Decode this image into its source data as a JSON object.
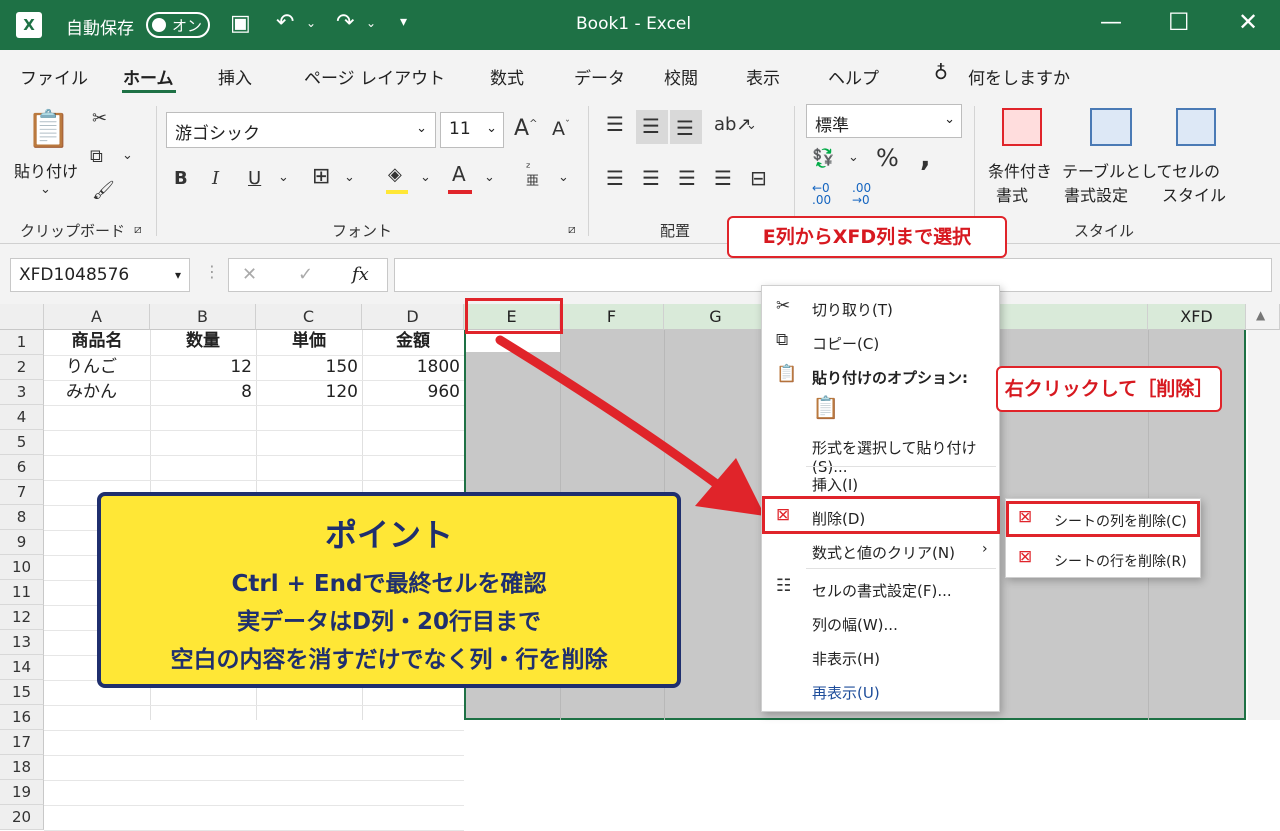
{
  "titlebar": {
    "autosave_label": "自動保存",
    "autosave_state": "オン",
    "title": "Book1 - Excel"
  },
  "menu": [
    "ファイル",
    "ホーム",
    "挿入",
    "ページ レイアウト",
    "数式",
    "データ",
    "校閲",
    "表示",
    "ヘルプ"
  ],
  "menu_active_index": 1,
  "tell_me": "何をしますか",
  "ribbon": {
    "clipboard": {
      "paste": "貼り付け",
      "group": "クリップボード"
    },
    "font": {
      "name": "游ゴシック",
      "size": "11",
      "group": "フォント"
    },
    "alignment": {
      "group": "配置"
    },
    "number": {
      "format": "標準"
    },
    "styles": {
      "conditional": [
        "条件付き",
        "書式"
      ],
      "table": [
        "テーブルとして",
        "書式設定"
      ],
      "cell": [
        "セルの",
        "スタイル"
      ],
      "group": "スタイル"
    }
  },
  "formula_bar": {
    "name_box": "XFD1048576",
    "fx": "fx"
  },
  "grid": {
    "columns": [
      "A",
      "B",
      "C",
      "D",
      "E",
      "F",
      "G",
      "XFD"
    ],
    "rows": [
      "1",
      "2",
      "3",
      "4",
      "5",
      "6",
      "7",
      "8",
      "9",
      "10",
      "11",
      "12",
      "13",
      "14",
      "15",
      "16",
      "17",
      "18",
      "19",
      "20"
    ],
    "header_row": [
      "商品名",
      "数量",
      "単価",
      "金額"
    ],
    "data_rows": [
      [
        "りんご",
        "12",
        "150",
        "1800"
      ],
      [
        "みかん",
        "8",
        "120",
        "960"
      ]
    ]
  },
  "callouts": {
    "select": "E列からXFD列まで選択",
    "right_click": "右クリックして［削除］"
  },
  "point": {
    "title": "ポイント",
    "lines": [
      "Ctrl + Endで最終セルを確認",
      "実データはD列・20行目まで",
      "空白の内容を消すだけでなく列・行を削除"
    ]
  },
  "context_menu": {
    "cut": "切り取り(T)",
    "copy": "コピー(C)",
    "paste_options": "貼り付けのオプション:",
    "paste_special": "形式を選択して貼り付け(S)...",
    "insert": "挿入(I)",
    "delete": "削除(D)",
    "clear": "数式と値のクリア(N)",
    "format_cells": "セルの書式設定(F)...",
    "col_width": "列の幅(W)...",
    "hide": "非表示(H)",
    "unhide": "再表示(U)"
  },
  "submenu": {
    "delete_cols": "シートの列を削除(C)",
    "delete_rows": "シートの行を削除(R)"
  },
  "colors": {
    "excel_green": "#1e7145",
    "callout_red": "#e0242a",
    "point_yellow": "#ffe736",
    "point_navy": "#1f2f6e"
  }
}
